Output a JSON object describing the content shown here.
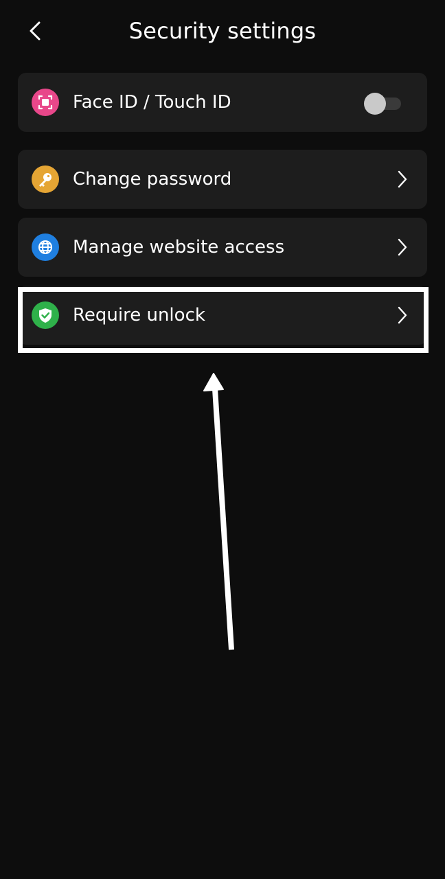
{
  "header": {
    "title": "Security settings",
    "back_icon": "chevron-left-icon"
  },
  "settings": {
    "face_id": {
      "label": "Face ID / Touch ID",
      "icon": "face-id-icon",
      "icon_color": "#e8478a",
      "toggle_on": false
    },
    "change_password": {
      "label": "Change password",
      "icon": "key-icon",
      "icon_color": "#e5a534"
    },
    "manage_website_access": {
      "label": "Manage website access",
      "icon": "globe-icon",
      "icon_color": "#1f7fe0"
    },
    "require_unlock": {
      "label": "Require unlock",
      "icon": "shield-check-icon",
      "icon_color": "#2fb14a"
    }
  },
  "colors": {
    "background": "#0d0d0d",
    "card": "#1d1d1d",
    "annotation": "#ffffff"
  }
}
